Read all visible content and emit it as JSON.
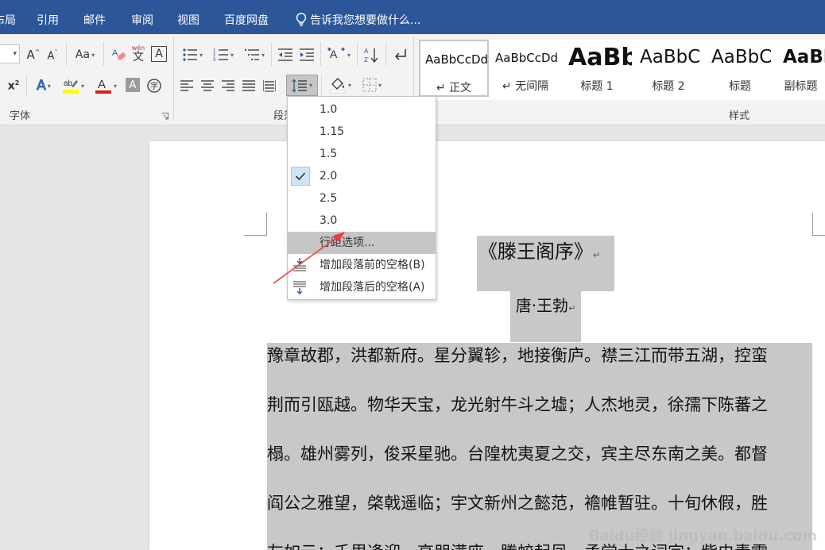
{
  "tabs": [
    {
      "label": "布局"
    },
    {
      "label": "引用"
    },
    {
      "label": "邮件"
    },
    {
      "label": "审阅"
    },
    {
      "label": "视图"
    },
    {
      "label": "百度网盘"
    }
  ],
  "tell_me": "告诉我您想要做什么...",
  "ribbon": {
    "font_group_label": "字体",
    "paragraph_group_label": "段落",
    "styles_group_label": "样式",
    "wen_label": "wén",
    "wen_char": "文",
    "change_case_label": "Aa"
  },
  "styles": [
    {
      "preview": "AaBbCcDd",
      "name": "↵ 正文",
      "selected": true
    },
    {
      "preview": "AaBbCcDd",
      "name": "↵ 无间隔"
    },
    {
      "preview": "AaBb",
      "name": "标题 1"
    },
    {
      "preview": "AaBbC",
      "name": "标题 2"
    },
    {
      "preview": "AaBbC",
      "name": "标题"
    },
    {
      "preview": "AaBb",
      "name": "副标题"
    }
  ],
  "line_spacing_menu": {
    "items": [
      "1.0",
      "1.15",
      "1.5",
      "2.0",
      "2.5",
      "3.0"
    ],
    "checked": "2.0",
    "options": "行距选项...",
    "add_before": "增加段落前的空格(B)",
    "add_after": "增加段落后的空格(A)"
  },
  "document": {
    "title": "《滕王阁序》",
    "author": "唐·王勃",
    "paragraph_mark": "↵",
    "lines": [
      "豫章故郡，洪都新府。星分翼轸，地接衡庐。襟三江而带五湖，控蛮",
      "荆而引瓯越。物华天宝，龙光射牛斗之墟；人杰地灵，徐孺下陈蕃之",
      "榻。雄州雾列，俊采星驰。台隍枕夷夏之交，宾主尽东南之美。都督",
      "阎公之雅望，棨戟遥临；宇文新州之懿范，襜帷暂驻。十旬休假，胜",
      "友如云；千里逢迎，高朋满座。腾蛟起凤，孟学士之词宗；紫电青霜"
    ]
  },
  "watermark": "Baidu经验 jingyan.baidu.com",
  "colors": {
    "tabbar": "#2b579a",
    "highlight": "#c8c8c8",
    "menu_hover": "#c6c6c6",
    "check_bg": "#cde6f7",
    "annotation_arrow": "#e8413a"
  }
}
